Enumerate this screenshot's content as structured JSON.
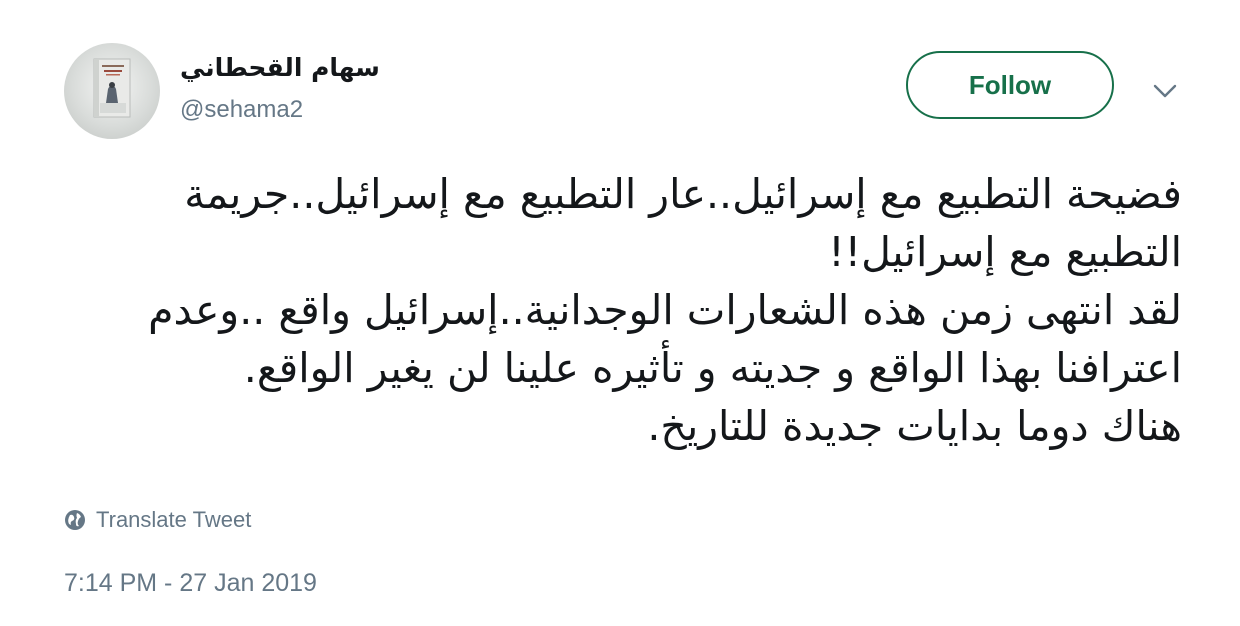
{
  "author": {
    "display_name": "سهام القحطاني",
    "handle": "@sehama2",
    "avatar_icon": "book-cover-avatar"
  },
  "actions": {
    "follow_label": "Follow",
    "more_icon": "chevron-down-icon"
  },
  "tweet": {
    "lines": [
      "فضيحة التطبيع مع إسرائيل..عار التطبيع مع إسرائيل..جريمة",
      "التطبيع مع إسرائيل!!",
      "لقد انتهى زمن هذه الشعارات الوجدانية..إسرائيل واقع ..وعدم",
      "اعترافنا بهذا الواقع و جديته و تأثيره علينا لن يغير الواقع.",
      "هناك دوما بدايات جديدة للتاريخ."
    ]
  },
  "translate": {
    "label": "Translate Tweet",
    "icon": "globe-icon"
  },
  "timestamp": "7:14 PM - 27 Jan 2019",
  "colors": {
    "accent": "#17704a",
    "muted": "#657786",
    "text": "#14171a"
  }
}
